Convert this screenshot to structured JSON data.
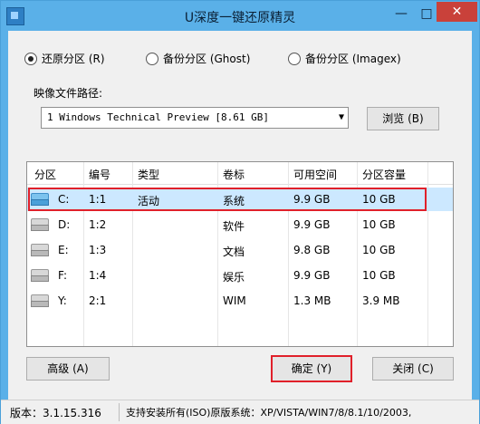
{
  "window": {
    "title": "U深度一键还原精灵"
  },
  "modes": [
    {
      "label": "还原分区 (R)",
      "checked": true
    },
    {
      "label": "备份分区 (Ghost)",
      "checked": false
    },
    {
      "label": "备份分区 (Imagex)",
      "checked": false
    }
  ],
  "image_path": {
    "label": "映像文件路径:",
    "value": "1 Windows Technical Preview [8.61 GB]",
    "browse_label": "浏览 (B)"
  },
  "table": {
    "columns": [
      "分区",
      "编号",
      "类型",
      "卷标",
      "可用空间",
      "分区容量"
    ],
    "rows": [
      [
        "C:",
        "1:1",
        "活动",
        "系统",
        "9.9 GB",
        "10 GB"
      ],
      [
        "D:",
        "1:2",
        "",
        "软件",
        "9.9 GB",
        "10 GB"
      ],
      [
        "E:",
        "1:3",
        "",
        "文档",
        "9.8 GB",
        "10 GB"
      ],
      [
        "F:",
        "1:4",
        "",
        "娱乐",
        "9.9 GB",
        "10 GB"
      ],
      [
        "Y:",
        "2:1",
        "",
        "WIM",
        "1.3 MB",
        "3.9 MB"
      ]
    ]
  },
  "buttons": {
    "advanced": "高级 (A)",
    "ok": "确定 (Y)",
    "close": "关闭 (C)"
  },
  "status": {
    "version": "版本：3.1.15.316",
    "support": "支持安装所有(ISO)原版系统：XP/VISTA/WIN7/8/8.1/10/2003,"
  }
}
